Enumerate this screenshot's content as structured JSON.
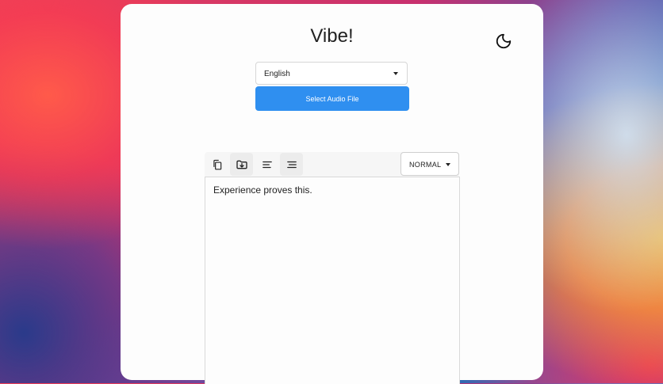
{
  "app": {
    "title": "Vibe!"
  },
  "header": {
    "theme_toggle_icon": "moon-icon"
  },
  "language": {
    "selected": "English"
  },
  "actions": {
    "select_audio_label": "Select Audio File"
  },
  "toolbar": {
    "buttons": [
      {
        "icon": "copy-icon"
      },
      {
        "icon": "download-folder-icon"
      },
      {
        "icon": "align-left-icon"
      },
      {
        "icon": "align-right-icon"
      }
    ],
    "mode": {
      "selected": "NORMAL"
    }
  },
  "editor": {
    "text": "Experience proves this."
  },
  "colors": {
    "accent": "#2f8ff0",
    "window_bg": "#fdfdfd"
  }
}
